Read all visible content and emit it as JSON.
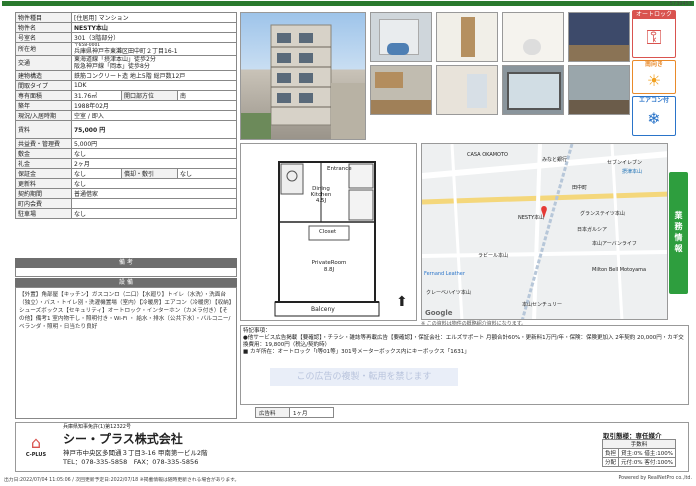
{
  "header": {
    "doc_number": "5739453"
  },
  "spec_rows": [
    {
      "label": "物件種目",
      "value": "[住居用] マンション"
    },
    {
      "label": "物件名",
      "value": "NESTY本山"
    },
    {
      "label": "号室名",
      "value": "301（3階部分）"
    }
  ],
  "address": {
    "label": "所在地",
    "postal": "〒658-0001",
    "value": "兵庫県神戸市東灘区田中町２丁目16-1"
  },
  "transport": {
    "label": "交通",
    "line1": "東海道線「摂津本山」徒歩2分",
    "line2": "阪急神戸線「岡本」徒歩8分"
  },
  "structure": {
    "label": "建物構造",
    "value": "鉄筋コンクリート造 地上5階 総戸数12戸"
  },
  "layout_type": {
    "label": "間取タイプ",
    "value": "1DK"
  },
  "area": {
    "label": "専有面積",
    "value": "31.76㎡",
    "dir_label": "開口部方位",
    "dir_value": "南"
  },
  "built": {
    "label": "築年",
    "value": "1988年02月"
  },
  "status": {
    "label": "現況/入居時期",
    "value": "空室 / 即入"
  },
  "rent": {
    "label": "賃料",
    "value": "75,000 円"
  },
  "fees": [
    {
      "label": "共益費・管理費",
      "value": "5,000円"
    },
    {
      "label": "敷金",
      "value": "なし"
    },
    {
      "label": "礼金",
      "value": "2ヶ月"
    }
  ],
  "deposit_row": {
    "label": "保証金",
    "value": "なし",
    "sub_label": "償却・敷引",
    "sub_value": "なし"
  },
  "renew": {
    "label": "更新料",
    "value": "なし"
  },
  "contract": {
    "label": "契約期間",
    "value": "普通借家"
  },
  "district": {
    "label": "町内会費",
    "value": ""
  },
  "parking": {
    "label": "駐車場",
    "value": "なし"
  },
  "bands": {
    "remarks": "備 考",
    "equipment": "設 備"
  },
  "facilities_text": "【外置】角部屋【キッチン】ガスコンロ（二口）【水廻り】トイレ（水洗）・洗面台（独立）・バス・トイレ別・洗濯機置場（室内）【冷暖房】エアコン（冷暖房）【収納】シューズボックス【セキュリティ】オートロック・インターホン（カメラ付き）【その他】備考1 室内物干し・照明付き・Wi-Fi ・ 給水・排水（公共下水）・バルコニー/ベランダ・照明・日当たり良好",
  "badges": [
    {
      "title": "オートロック",
      "color": "#d9534f"
    },
    {
      "title": "南向き",
      "color": "#e98a2a"
    },
    {
      "title": "エアコン付",
      "color": "#2a74c9"
    }
  ],
  "floorplan": {
    "entrance": "Entrance",
    "dk": "Dining Kitchen",
    "dk_size": "4.5J",
    "closet": "Closet",
    "room": "PrivateRoom",
    "room_size": "8.8J",
    "balcony": "Balceny"
  },
  "map": {
    "labels": [
      "CASA OKAMOTO",
      "みなと銀行",
      "セブンイレブン",
      "摂津本山",
      "田中町",
      "NESTY本山",
      "グランステイツ本山",
      "日本ガルシア",
      "本山アーバンライフ",
      "Milton Bell Motoyama",
      "Fernand Leather",
      "クレーベハイツ本山",
      "本山センチュリー",
      "ラビール本山",
      "Google"
    ],
    "note": "※ この資料は物件の概略紹介資料になります。"
  },
  "side_tab": "業務情報",
  "notes": {
    "title": "特記事項：",
    "line1": "●他サービス広告掲載【要確認】・チラシ・雑誌等再載広告【要確認】・保証会社：エルズサポート 月額合計60%・更新料1万円/年・保険：保険更加入 2年契約 20,000円・カギ交換費用：19,800円（税込/契約時）",
    "line2": "■ カギ所在：オートロック「I等01等」301号メーターボックス内にキーボックス「1631」"
  },
  "watermark": "この広告の複製・転用を禁じます",
  "ad_period": {
    "label": "広告料",
    "value": "1ヶ月"
  },
  "company": {
    "license": "兵庫県知事免許(1)第12322号",
    "logo_text": "C-PLUS",
    "name": "シー・プラス株式会社",
    "address": "神戸市中央区多聞通３丁目3-16 甲南第一ビル2階",
    "tel": "TEL：078-335-5858　FAX：078-335-5856"
  },
  "transaction": {
    "title": "取引態様：専任媒介",
    "fee_title": "手数料",
    "rows": [
      {
        "label": "負担",
        "value": "貸主:0% 借主:100%"
      },
      {
        "label": "分配",
        "value": "元付:0% 客付:100%"
      }
    ]
  },
  "bottom": {
    "left": "出力日:2022/07/04 11:05:06 / 次回更新予定日:2022/07/18 ※掲載情報は随時更新される場合があります。",
    "right": "Powered by RealNetPro co.,ltd."
  }
}
